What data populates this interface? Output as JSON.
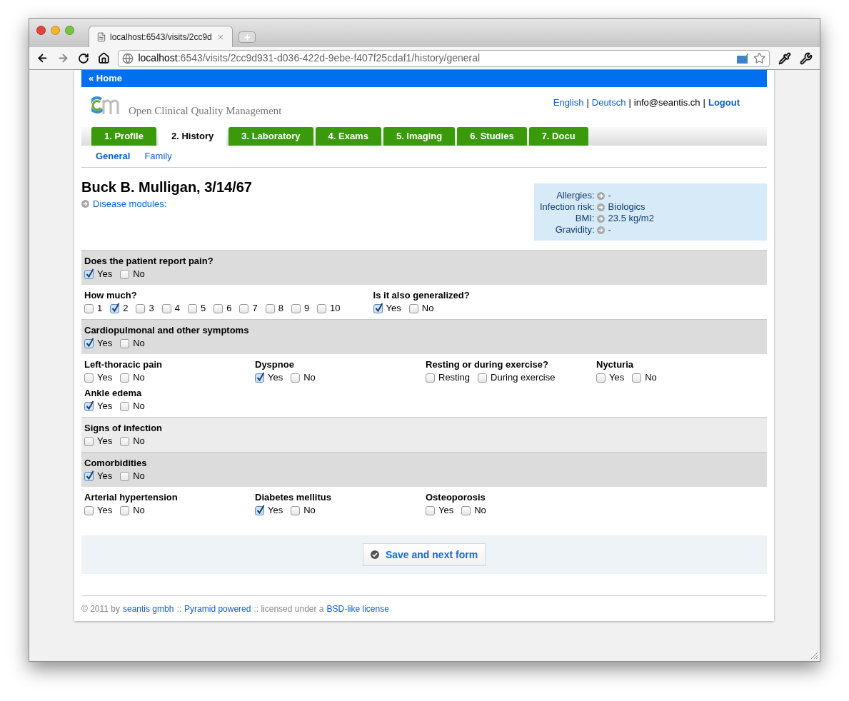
{
  "browser": {
    "tab_title": "localhost:6543/visits/2cc9d",
    "url_host": "localhost",
    "url_path": ":6543/visits/2cc9d931-d036-422d-9ebe-f407f25cdaf1/history/general"
  },
  "header": {
    "home_link": "« Home",
    "app_title": "Open Clinical Quality Management",
    "user_bar": [
      {
        "kind": "link",
        "text": "English"
      },
      {
        "kind": "separator",
        "text": "|"
      },
      {
        "kind": "link",
        "text": "Deutsch"
      },
      {
        "kind": "separator",
        "text": "|"
      },
      {
        "kind": "text",
        "text": "info@seantis.ch"
      },
      {
        "kind": "separator",
        "text": "|"
      },
      {
        "kind": "strong_link",
        "text": "Logout"
      }
    ]
  },
  "tabs": [
    {
      "label": "1. Profile",
      "selected": false
    },
    {
      "label": "2. History",
      "selected": true
    },
    {
      "label": "3. Laboratory",
      "selected": false
    },
    {
      "label": "4. Exams",
      "selected": false
    },
    {
      "label": "5. Imaging",
      "selected": false
    },
    {
      "label": "6. Studies",
      "selected": false
    },
    {
      "label": "7. Docu",
      "selected": false
    }
  ],
  "subtabs": [
    {
      "label": "General",
      "selected": true
    },
    {
      "label": "Family",
      "selected": false
    }
  ],
  "patient": {
    "name": "Buck B. Mulligan, 3/14/67",
    "disease_modules": "Disease modules:"
  },
  "info_box": [
    {
      "label": "Allergies:",
      "value": "-"
    },
    {
      "label": "Infection risk:",
      "value": "Biologics"
    },
    {
      "label": "BMI:",
      "value": "23.5 kg/m2"
    },
    {
      "label": "Gravidity:",
      "value": "-"
    }
  ],
  "sections": [
    {
      "kind": "question",
      "highlighted": false,
      "fields": [
        {
          "label": "Does the patient report pain?",
          "options": [
            {
              "label": "Yes",
              "checked": true
            },
            {
              "label": "No",
              "checked": false
            }
          ]
        }
      ]
    },
    {
      "kind": "details",
      "fields": [
        {
          "label": "How much?",
          "options": [
            {
              "label": "1",
              "checked": false
            },
            {
              "label": "2",
              "checked": true
            },
            {
              "label": "3",
              "checked": false
            },
            {
              "label": "4",
              "checked": false
            },
            {
              "label": "5",
              "checked": false
            },
            {
              "label": "6",
              "checked": false
            },
            {
              "label": "7",
              "checked": false
            },
            {
              "label": "8",
              "checked": false
            },
            {
              "label": "9",
              "checked": false
            },
            {
              "label": "10",
              "checked": false
            }
          ]
        },
        {
          "label": "Is it also generalized?",
          "options": [
            {
              "label": "Yes",
              "checked": true
            },
            {
              "label": "No",
              "checked": false
            }
          ]
        }
      ]
    },
    {
      "kind": "question",
      "highlighted": false,
      "fields": [
        {
          "label": "Cardiopulmonal and other symptoms",
          "options": [
            {
              "label": "Yes",
              "checked": true
            },
            {
              "label": "No",
              "checked": false
            }
          ]
        }
      ]
    },
    {
      "kind": "details",
      "fields": [
        {
          "label": "Left-thoracic pain",
          "options": [
            {
              "label": "Yes",
              "checked": false
            },
            {
              "label": "No",
              "checked": false
            }
          ]
        },
        {
          "label": "Dyspnoe",
          "options": [
            {
              "label": "Yes",
              "checked": true
            },
            {
              "label": "No",
              "checked": false
            }
          ]
        },
        {
          "label": "Resting or during exercise?",
          "options": [
            {
              "label": "Resting",
              "checked": false
            },
            {
              "label": "During exercise",
              "checked": false
            }
          ]
        },
        {
          "label": "Nycturia",
          "options": [
            {
              "label": "Yes",
              "checked": false
            },
            {
              "label": "No",
              "checked": false
            }
          ]
        },
        {
          "label": "Ankle edema",
          "options": [
            {
              "label": "Yes",
              "checked": true
            },
            {
              "label": "No",
              "checked": false
            }
          ]
        }
      ]
    },
    {
      "kind": "question",
      "highlighted": true,
      "fields": [
        {
          "label": "Signs of infection",
          "options": [
            {
              "label": "Yes",
              "checked": false
            },
            {
              "label": "No",
              "checked": false
            }
          ]
        }
      ]
    },
    {
      "kind": "question",
      "highlighted": false,
      "fields": [
        {
          "label": "Comorbidities",
          "options": [
            {
              "label": "Yes",
              "checked": true
            },
            {
              "label": "No",
              "checked": false
            }
          ]
        }
      ]
    },
    {
      "kind": "details",
      "fields": [
        {
          "label": "Arterial hypertension",
          "options": [
            {
              "label": "Yes",
              "checked": false
            },
            {
              "label": "No",
              "checked": false
            }
          ]
        },
        {
          "label": "Diabetes mellitus",
          "options": [
            {
              "label": "Yes",
              "checked": true
            },
            {
              "label": "No",
              "checked": false
            }
          ]
        },
        {
          "label": "Osteoporosis",
          "options": [
            {
              "label": "Yes",
              "checked": false
            },
            {
              "label": "No",
              "checked": false
            }
          ]
        }
      ]
    }
  ],
  "save_button": "Save and next form",
  "footer": [
    {
      "kind": "text",
      "text": "© 2011 by"
    },
    {
      "kind": "link",
      "text": "seantis gmbh"
    },
    {
      "kind": "text",
      "text": "::"
    },
    {
      "kind": "link",
      "text": "Pyramid powered"
    },
    {
      "kind": "text",
      "text": ":: licensed under a"
    },
    {
      "kind": "link",
      "text": "BSD-like license"
    }
  ]
}
